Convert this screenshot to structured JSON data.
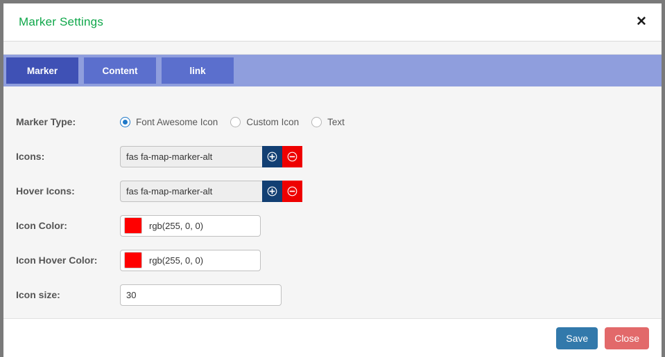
{
  "modal": {
    "title": "Marker Settings",
    "close_icon": "close-x-icon"
  },
  "tabs": [
    {
      "label": "Marker",
      "active": true
    },
    {
      "label": "Content",
      "active": false
    },
    {
      "label": "link",
      "active": false
    }
  ],
  "form": {
    "marker_type": {
      "label": "Marker Type:",
      "options": [
        {
          "label": "Font Awesome Icon",
          "selected": true
        },
        {
          "label": "Custom Icon",
          "selected": false
        },
        {
          "label": "Text",
          "selected": false
        }
      ]
    },
    "icons": {
      "label": "Icons:",
      "value": "fas fa-map-marker-alt",
      "add_icon": "circle-plus-icon",
      "remove_icon": "circle-minus-icon"
    },
    "hover_icons": {
      "label": "Hover Icons:",
      "value": "fas fa-map-marker-alt",
      "add_icon": "circle-plus-icon",
      "remove_icon": "circle-minus-icon"
    },
    "icon_color": {
      "label": "Icon Color:",
      "value": "rgb(255, 0, 0)",
      "swatch": "#ff0000"
    },
    "icon_hover_color": {
      "label": "Icon Hover Color:",
      "value": "rgb(255, 0, 0)",
      "swatch": "#ff0000"
    },
    "icon_size": {
      "label": "Icon size:",
      "value": "30"
    }
  },
  "footer": {
    "save_label": "Save",
    "close_label": "Close"
  },
  "colors": {
    "title_green": "#0fa74a",
    "tab_bar": "#8f9edd",
    "tab_inactive": "#5b6fcd",
    "tab_active": "#3f51b5",
    "add_button": "#123f73",
    "remove_button": "#ee0000",
    "save_button": "#3279ab",
    "close_button": "#e2696a",
    "body_bg": "#f5f5f5"
  }
}
